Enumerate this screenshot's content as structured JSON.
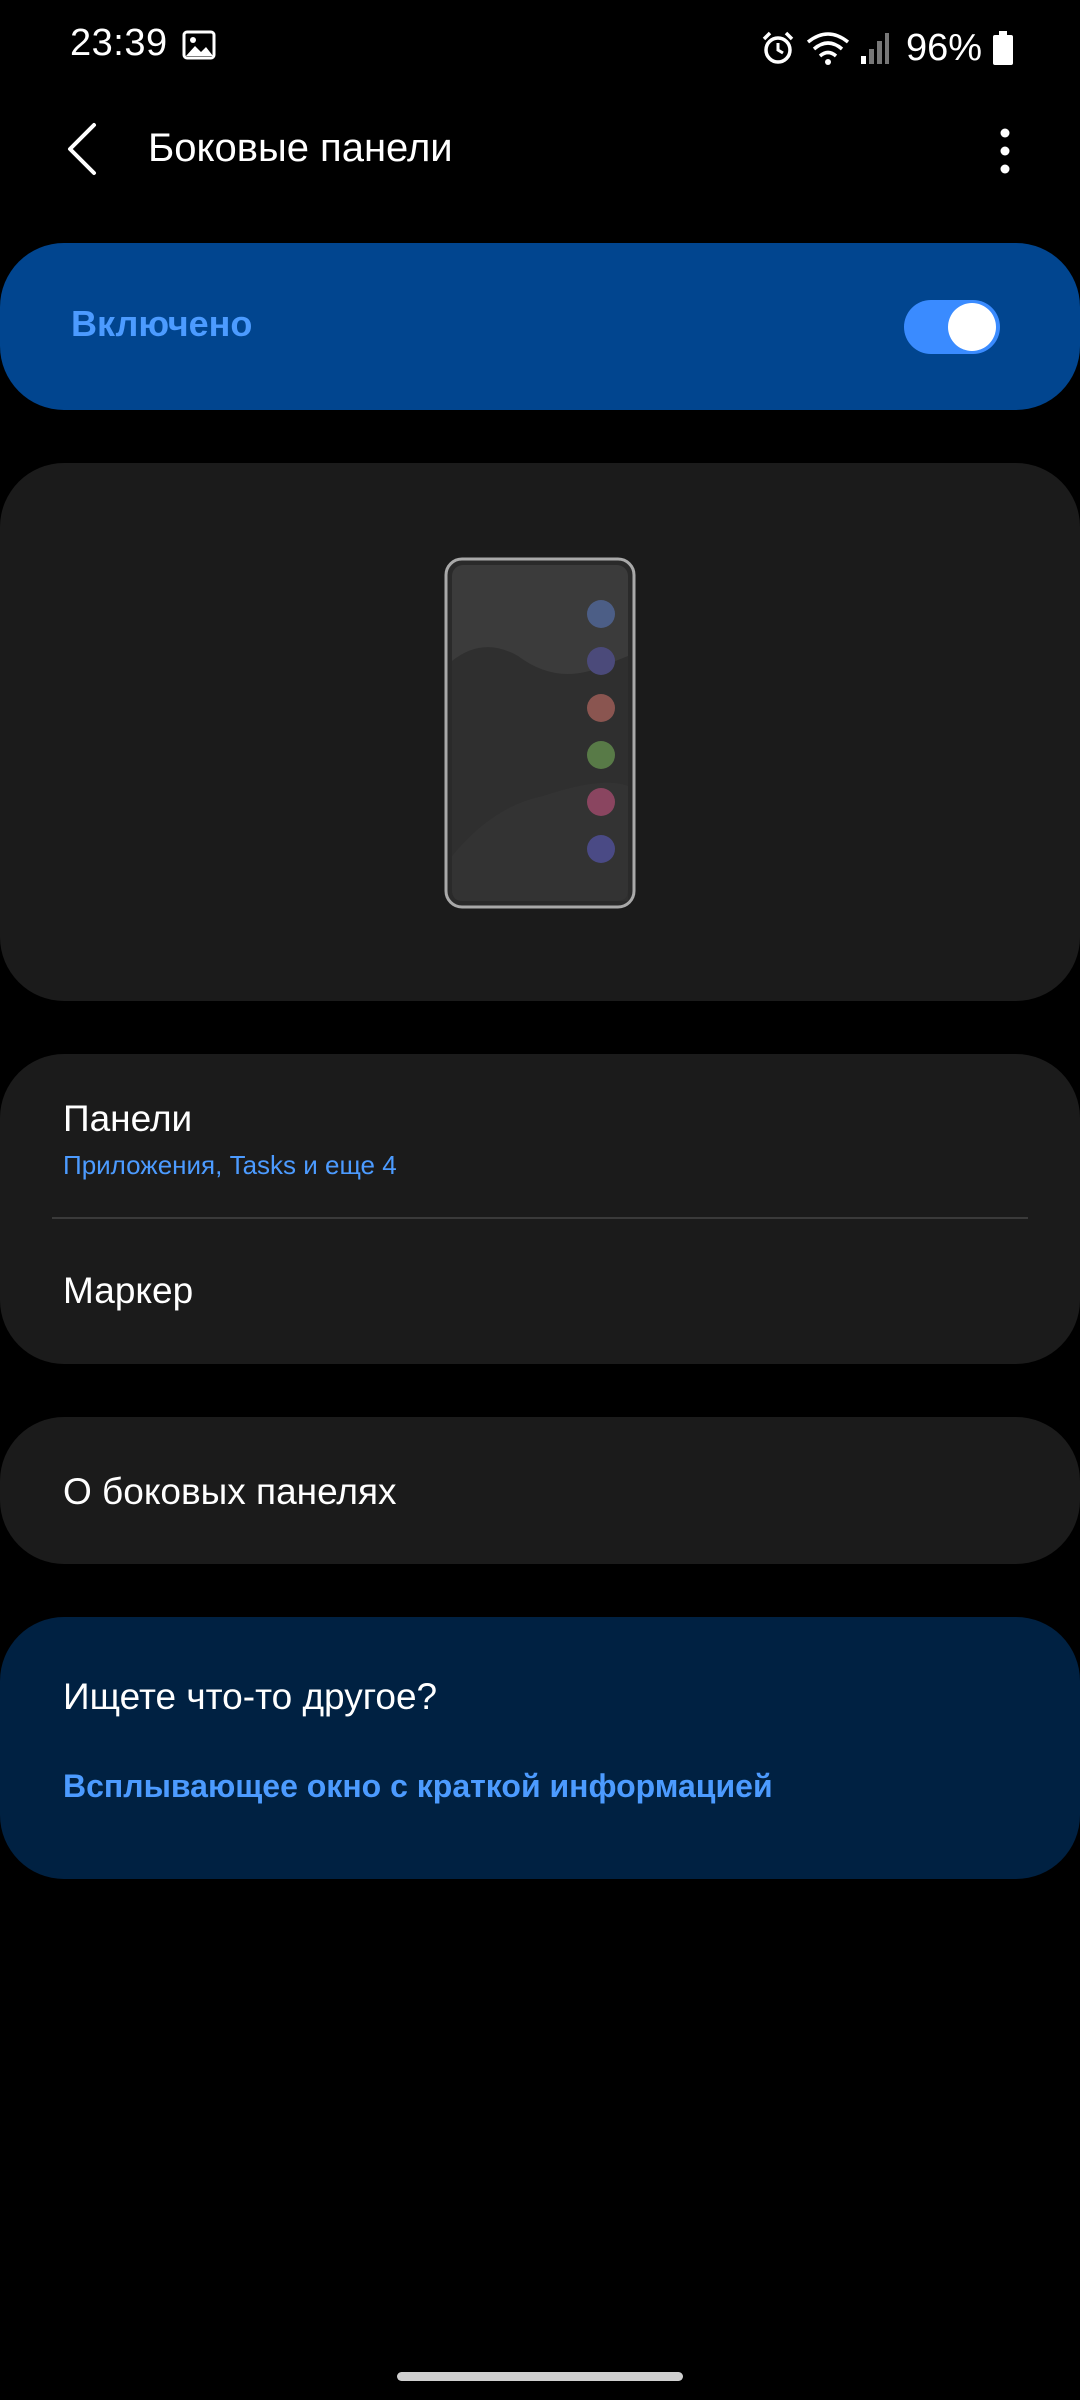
{
  "status_bar": {
    "time": "23:39",
    "battery_percent": "96%",
    "icons": [
      "gallery-icon",
      "alarm-icon",
      "wifi-icon",
      "signal-icon",
      "battery-icon"
    ]
  },
  "app_bar": {
    "title": "Боковые панели",
    "back_icon": "chevron-left-icon",
    "more_icon": "more-vertical-icon"
  },
  "master_switch": {
    "label": "Включено",
    "on": true
  },
  "preview": {
    "dot_colors": [
      "#4c5e86",
      "#4b4a7a",
      "#8a5550",
      "#587a47",
      "#8a4560",
      "#4a4a85"
    ]
  },
  "settings_list": {
    "panels": {
      "title": "Панели",
      "subtitle": "Приложения, Tasks и еще 4"
    },
    "handle": {
      "title": "Маркер"
    }
  },
  "about": {
    "title": "О боковых панелях"
  },
  "looking_for": {
    "title": "Ищете что-то другое?",
    "link": "Всплывающее окно с краткой информацией"
  },
  "colors": {
    "accent": "#4c9bff",
    "toggle": "#3a8bff",
    "switch_card": "#01458f",
    "card": "#1b1b1b",
    "suggestion_card": "#002142",
    "background": "#000000"
  }
}
